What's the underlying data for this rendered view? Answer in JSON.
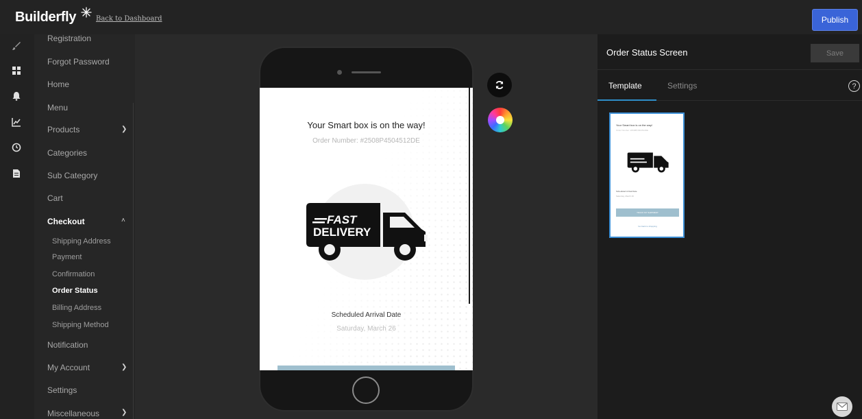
{
  "topbar": {
    "logo": "Builderfly",
    "back_link": "Back to Dashboard",
    "publish_label": "Publish"
  },
  "rail": {
    "icons": [
      "brush-icon",
      "grid-icon",
      "bell-icon",
      "chart-icon",
      "clock-icon",
      "document-icon"
    ]
  },
  "menu": {
    "items": {
      "registration": "Registration",
      "forgot_password": "Forgot Password",
      "home": "Home",
      "menu": "Menu",
      "products": "Products",
      "categories": "Categories",
      "sub_category": "Sub Category",
      "cart": "Cart",
      "checkout": "Checkout",
      "notification": "Notification",
      "my_account": "My Account",
      "settings": "Settings",
      "miscellaneous": "Miscellaneous"
    },
    "checkout_subitems": {
      "shipping_address": "Shipping Address",
      "payment": "Payment",
      "confirmation": "Confirmation",
      "order_status": "Order Status",
      "billing_address": "Billing Address",
      "shipping_method": "Shipping Method"
    },
    "active_item": "Checkout",
    "active_subitem": "Order Status"
  },
  "preview": {
    "title": "Your Smart box is on the way!",
    "order_number": "Order Number: #2508P4504512DE",
    "truck_text_line1": "FAST",
    "truck_text_line2": "DELIVERY",
    "arrival_label": "Scheduled Arrival Date",
    "arrival_date": "Saturday, March 26"
  },
  "panel": {
    "title": "Order Status Screen",
    "save_label": "Save",
    "tabs": {
      "template": "Template",
      "settings": "Settings"
    },
    "active_tab": "Template",
    "help": "?"
  },
  "thumbnail": {
    "title": "Your Smart box is on the way!",
    "sub": "Order Number: #2508P4504512DE",
    "label": "Scheduled Arrival Date",
    "date": "Saturday, March 26",
    "button": "TRACK MY SHIPMENT",
    "link": "Go back to shopping"
  },
  "colors": {
    "accent": "#3a64d8",
    "tab_underline": "#2f8ec9",
    "track_bar": "#9fbfce"
  }
}
